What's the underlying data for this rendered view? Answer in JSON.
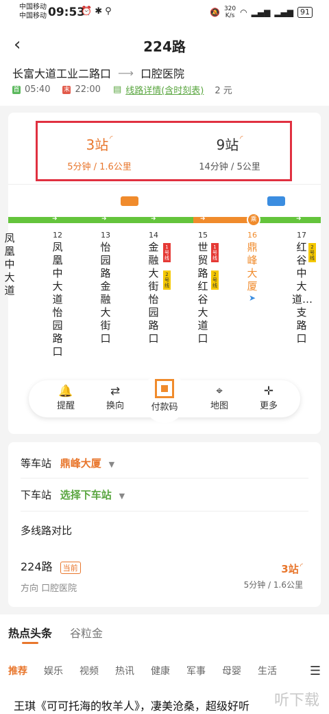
{
  "status_bar": {
    "carrier1": "中国移动",
    "carrier2": "中国移动",
    "time": "09:53",
    "speed_value": "320",
    "speed_unit": "K/s",
    "battery": "91"
  },
  "header": {
    "title": "224路",
    "from": "长富大道工业二路口",
    "to": "口腔医院",
    "first_tag": "首",
    "first_time": "05:40",
    "last_tag": "末",
    "last_time": "22:00",
    "detail_link": "线路详情(含时刻表)",
    "fare": "2 元"
  },
  "eta": [
    {
      "stops": "3站",
      "detail": "5分钟 / 1.6公里"
    },
    {
      "stops": "9站",
      "detail": "14分钟 / 5公里"
    }
  ],
  "stations": [
    {
      "num": "",
      "name": "凤凰中大道"
    },
    {
      "num": "12",
      "name": "凤凰中大道怡园路口"
    },
    {
      "num": "13",
      "name": "怡园路金融大街口"
    },
    {
      "num": "14",
      "name": "金融大街怡园路口"
    },
    {
      "num": "15",
      "name": "世贸路红谷大道口"
    },
    {
      "num": "16",
      "name": "鼎峰大厦"
    },
    {
      "num": "17",
      "name": "红谷中大道…支路口"
    }
  ],
  "metro_tags": {
    "line1": "1号线",
    "line2": "2号线"
  },
  "current_stop_icon": "乘",
  "actions": {
    "remind": "提醒",
    "reverse": "换向",
    "pay": "付款码",
    "map": "地图",
    "more": "更多"
  },
  "wait": {
    "label": "等车站",
    "value": "鼎峰大厦"
  },
  "alight": {
    "label": "下车站",
    "value": "选择下车站"
  },
  "compare": {
    "label": "多线路对比",
    "line": "224路",
    "current_tag": "当前",
    "direction": "方向 口腔医院",
    "stops": "3站",
    "detail": "5分钟 / 1.6公里"
  },
  "news": {
    "tabs": [
      "热点头条",
      "谷粒金"
    ],
    "categories": [
      "推荐",
      "娱乐",
      "视频",
      "热讯",
      "健康",
      "军事",
      "母婴",
      "生活"
    ],
    "headline": "王琪《可可托海的牧羊人》，凄美沧桑，超级好听",
    "watermark": "听下载"
  },
  "colors": {
    "accent": "#e8762c",
    "green": "#5aa640",
    "highlight_box": "#e03040",
    "blue": "#3b8de0"
  }
}
